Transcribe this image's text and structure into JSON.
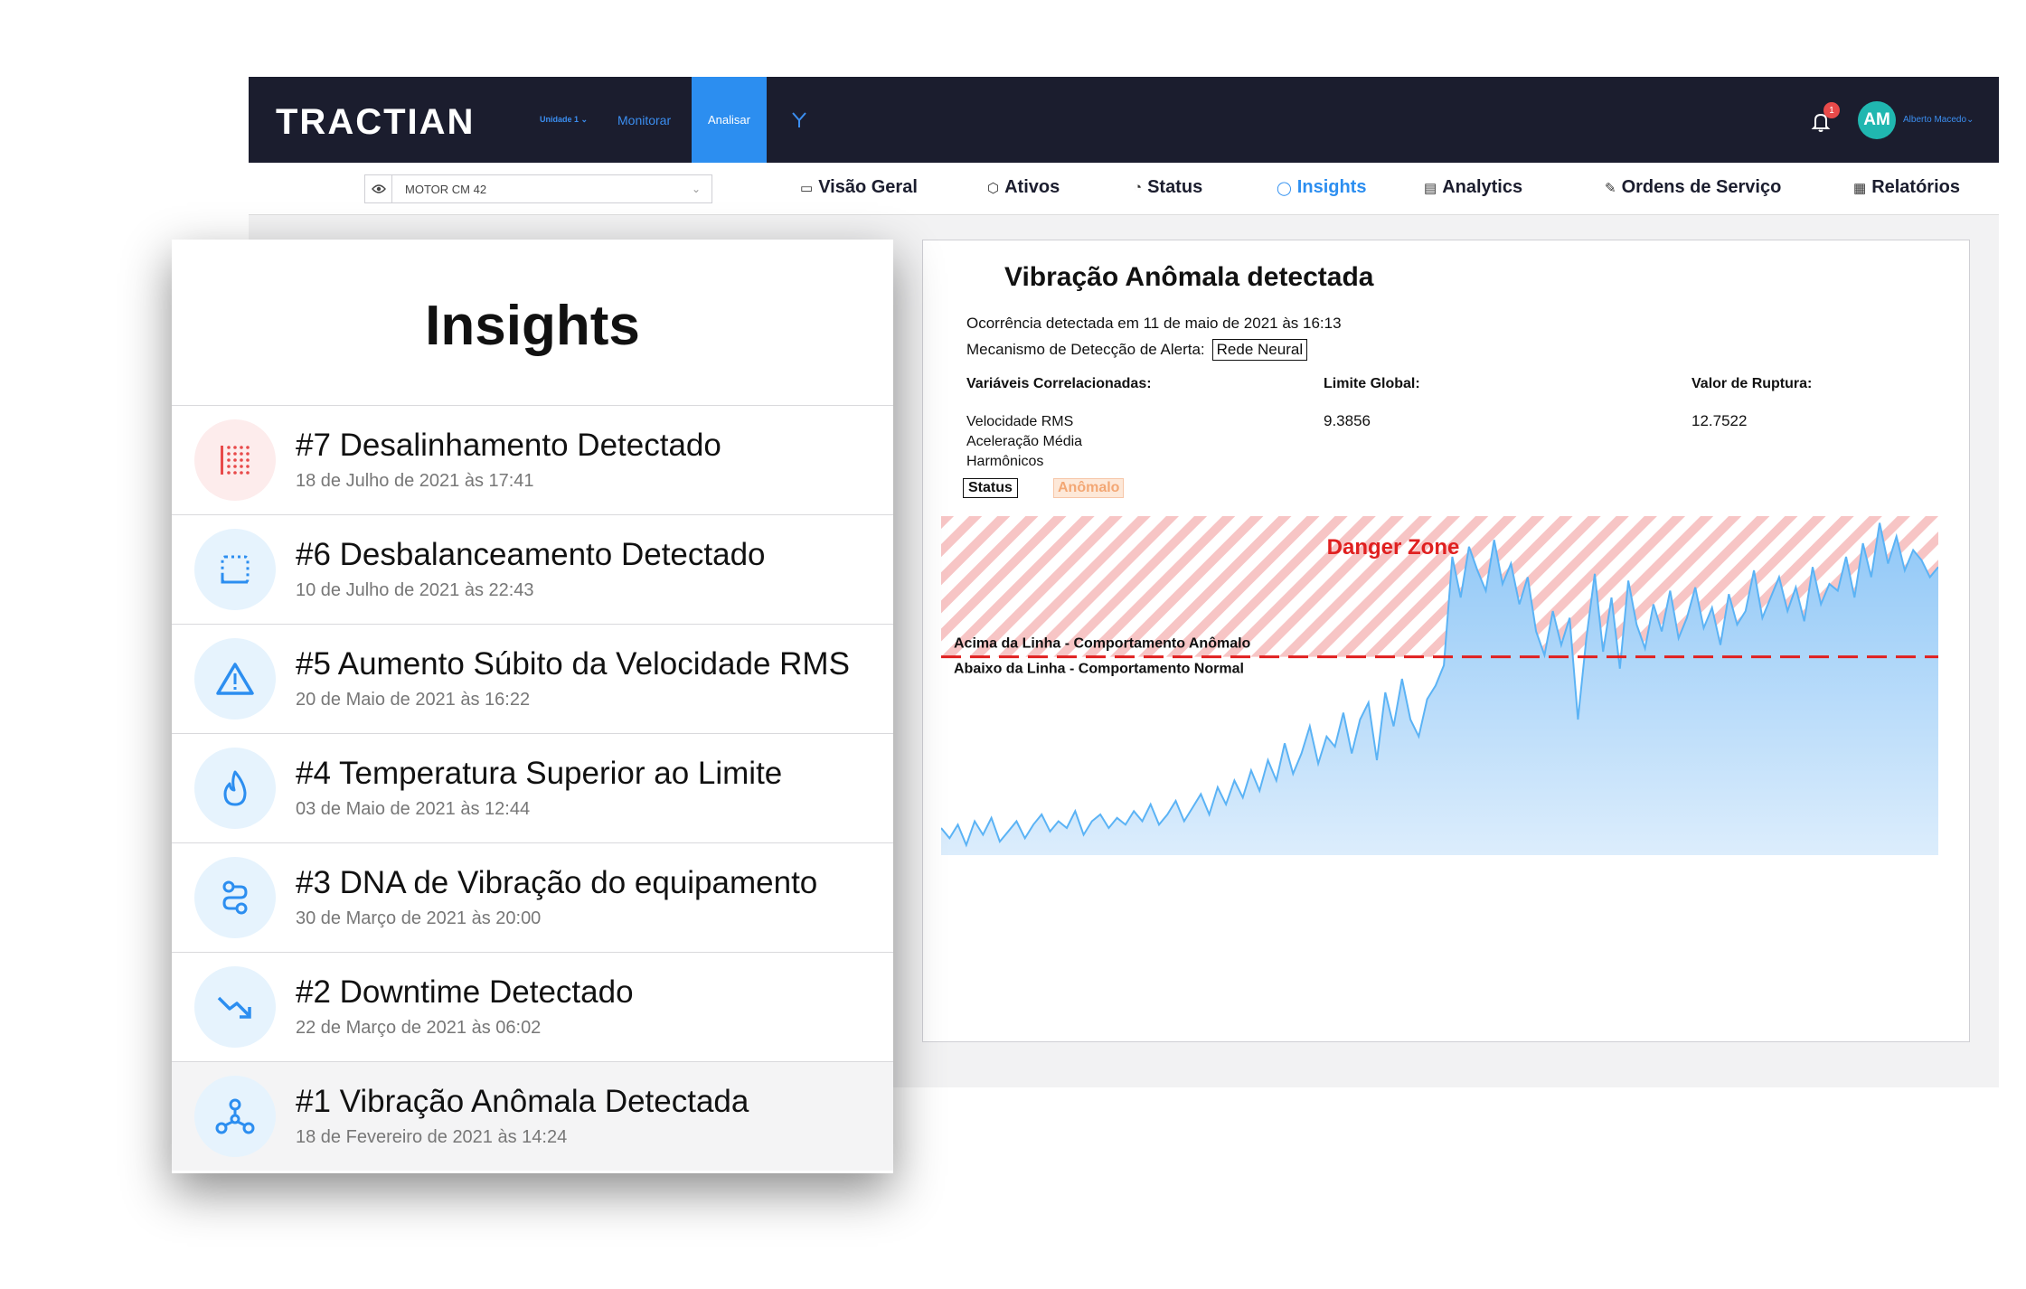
{
  "app": {
    "logo": "TRACTIAN",
    "unit_select": "Unidade 1",
    "nav": {
      "monitor": "Monitorar",
      "analyze": "Analisar"
    },
    "notifications": "1",
    "avatar_initials": "AM",
    "user_name": "Alberto Macedo"
  },
  "subnav": {
    "asset": "MOTOR CM 42",
    "tabs": [
      "Visão Geral",
      "Ativos",
      "Status",
      "Insights",
      "Analytics",
      "Ordens de Serviço",
      "Relatórios"
    ],
    "active_tab": "Insights"
  },
  "detail": {
    "title": "Vibração Anômala detectada",
    "occurrence": "Ocorrência detectada em 11 de maio de 2021 às 16:13",
    "mechanism_label": "Mecanismo de Detecção de Alerta:",
    "mechanism_value": "Rede Neural",
    "vars_header": "Variáveis Correlacionadas:",
    "limit_header": "Limite Global:",
    "rupture_header": "Valor de Ruptura:",
    "variables": [
      "Velocidade RMS",
      "Aceleração Média",
      "Harmônicos"
    ],
    "limit_value": "9.3856",
    "rupture_value": "12.7522",
    "legend_status": "Status",
    "legend_anomalous": "Anômalo"
  },
  "chart_data": {
    "type": "area",
    "danger_zone_label": "Danger Zone",
    "above_line_label": "Acima da Linha - Comportamento Anômalo",
    "below_line_label": "Abaixo da Linha - Comportamento Normal",
    "threshold_fraction": 0.585,
    "colors": {
      "fill": "#9fd0fa",
      "line": "#5bb3f5",
      "danger": "#f08b8b",
      "threshold": "#e02020"
    },
    "values": [
      0.08,
      0.05,
      0.09,
      0.03,
      0.1,
      0.06,
      0.11,
      0.04,
      0.07,
      0.1,
      0.05,
      0.09,
      0.12,
      0.07,
      0.1,
      0.08,
      0.13,
      0.06,
      0.1,
      0.12,
      0.08,
      0.11,
      0.09,
      0.13,
      0.1,
      0.15,
      0.09,
      0.12,
      0.16,
      0.1,
      0.14,
      0.18,
      0.12,
      0.2,
      0.15,
      0.22,
      0.17,
      0.25,
      0.19,
      0.28,
      0.22,
      0.33,
      0.24,
      0.3,
      0.38,
      0.27,
      0.35,
      0.32,
      0.42,
      0.3,
      0.4,
      0.45,
      0.28,
      0.48,
      0.38,
      0.52,
      0.4,
      0.35,
      0.46,
      0.5,
      0.56,
      0.88,
      0.76,
      0.91,
      0.84,
      0.78,
      0.93,
      0.8,
      0.86,
      0.74,
      0.82,
      0.66,
      0.59,
      0.72,
      0.62,
      0.7,
      0.4,
      0.64,
      0.83,
      0.6,
      0.76,
      0.55,
      0.81,
      0.68,
      0.61,
      0.74,
      0.66,
      0.78,
      0.64,
      0.7,
      0.79,
      0.67,
      0.73,
      0.62,
      0.77,
      0.68,
      0.72,
      0.84,
      0.7,
      0.76,
      0.82,
      0.72,
      0.79,
      0.69,
      0.85,
      0.74,
      0.8,
      0.78,
      0.88,
      0.76,
      0.92,
      0.82,
      0.98,
      0.86,
      0.94,
      0.84,
      0.9,
      0.87,
      0.82,
      0.85
    ]
  }
}
